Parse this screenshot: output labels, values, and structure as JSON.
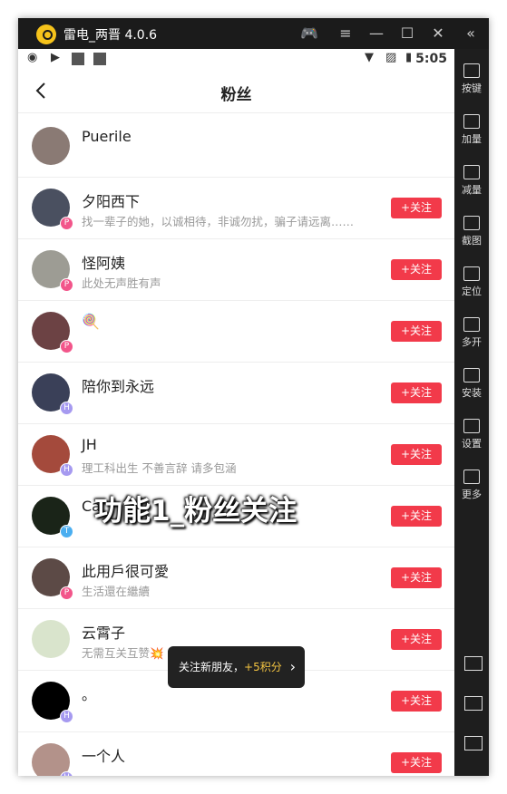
{
  "window": {
    "title": "雷电_两晋 4.0.6",
    "controls": [
      "gamepad-icon",
      "menu-icon",
      "minimize-icon",
      "maximize-icon",
      "close-icon",
      "collapse-icon"
    ]
  },
  "status_bar": {
    "time": "5:05"
  },
  "header": {
    "title": "粉丝"
  },
  "followers": [
    {
      "name": "Puerile",
      "bio": "",
      "badge": "",
      "badge_color": "",
      "avatar_color": "#8a7a74",
      "button": ""
    },
    {
      "name": "夕阳西下",
      "bio": "找一辈子的她，以诚相待，非诚勿扰，骗子请远离……",
      "badge": "P",
      "badge_color": "#f2558a",
      "avatar_color": "#4a5060",
      "button": "+关注"
    },
    {
      "name": "怪阿姨",
      "bio": "此处无声胜有声",
      "badge": "P",
      "badge_color": "#f2558a",
      "avatar_color": "#9d9c94",
      "button": "+关注"
    },
    {
      "name": "🍭",
      "bio": "",
      "badge": "P",
      "badge_color": "#f2558a",
      "avatar_color": "#6c4244",
      "button": "+关注"
    },
    {
      "name": "陪你到永远",
      "bio": "",
      "badge": "H",
      "badge_color": "#a69af0",
      "avatar_color": "#3a4058",
      "button": "+关注"
    },
    {
      "name": "JH",
      "bio": "理工科出生 不善言辞 请多包涵",
      "badge": "H",
      "badge_color": "#a69af0",
      "avatar_color": "#a44a3c",
      "button": "+关注"
    },
    {
      "name": "Ca",
      "bio": "",
      "badge": "T",
      "badge_color": "#4aaef0",
      "avatar_color": "#1a2418",
      "button": "+关注"
    },
    {
      "name": "此用戶很可愛",
      "bio": "生活還在繼續",
      "badge": "P",
      "badge_color": "#f2558a",
      "avatar_color": "#5c4a46",
      "button": "+关注"
    },
    {
      "name": "云霄子",
      "bio": "无需互关互赞💥",
      "badge": "",
      "badge_color": "",
      "avatar_color": "#d9e4cc",
      "button": "+关注"
    },
    {
      "name": "。",
      "bio": "",
      "badge": "H",
      "badge_color": "#a69af0",
      "avatar_color": "#000000",
      "button": "+关注"
    },
    {
      "name": "一个人",
      "bio": "",
      "badge": "H",
      "badge_color": "#a69af0",
      "avatar_color": "#b3928a",
      "button": "+关注"
    }
  ],
  "sidebar": {
    "items": [
      {
        "label": "按键",
        "icon": "keyboard-icon"
      },
      {
        "label": "加量",
        "icon": "volume-up-icon"
      },
      {
        "label": "减量",
        "icon": "volume-down-icon"
      },
      {
        "label": "截图",
        "icon": "screenshot-icon"
      },
      {
        "label": "定位",
        "icon": "location-icon"
      },
      {
        "label": "多开",
        "icon": "multi-instance-icon"
      },
      {
        "label": "安装",
        "icon": "install-icon"
      },
      {
        "label": "设置",
        "icon": "settings-icon"
      },
      {
        "label": "更多",
        "icon": "more-icon"
      }
    ],
    "nav": [
      "back-icon",
      "home-icon",
      "recents-icon"
    ]
  },
  "overlay": {
    "watermark": "功能1_粉丝关注",
    "toast_text": "关注新朋友，",
    "toast_points": "+5积分"
  },
  "colors": {
    "follow_button": "#f23a4a",
    "titlebar": "#1b1b1b",
    "points": "#f4c542"
  }
}
